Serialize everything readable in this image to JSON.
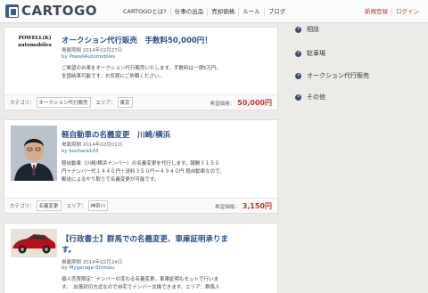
{
  "header": {
    "logo_text": "CARTOGO",
    "nav": [
      "CARTOGOとは?",
      "仕事の出品",
      "売却価格",
      "ルール",
      "ブログ"
    ],
    "account": [
      "新規登録",
      "ログイン"
    ]
  },
  "listings": [
    {
      "thumb_text": "POWELL(K)\nautomobiles",
      "title": "オークション代行販売　手数料50,000円！",
      "date": "掲載期間  2014年02月27日",
      "by_label": "by",
      "author": "PowellAutomobiles",
      "description": [
        "ご希望のお車をオークション代行販売いたします。手数料は一律5万円。",
        "全国納車可能です。お気軽にご依頼ください。"
      ],
      "category_label": "カテゴリ：",
      "category": "オークション代行販売",
      "area_label": "エリア：",
      "area": "東京",
      "price_label": "希望価格：",
      "price": "50,000円"
    },
    {
      "title": "軽自動車の名義変更　川崎/横浜",
      "date": "掲載期間  2014年02月01日",
      "by_label": "by",
      "author": "kouhara103",
      "description": [
        "軽自動車（川崎/横浜ナンバー）の名義変更を代行します。報酬３１５０",
        "円＋ナンバー代１４４０円＋送料３５０円＝４９４０円 軽自動車なので、",
        "郵送によるやり取りで名義変更が可能です。"
      ],
      "category_label": "カテゴリ：",
      "category": "名義変更",
      "area_label": "エリア：",
      "area": "神奈川",
      "price_label": "希望価格：",
      "price": "3,150円"
    },
    {
      "title_lines": [
        "【行政書士】群馬での名義変更、車庫証明承りま",
        "す。"
      ],
      "date": "掲載期間  2014年02月24日",
      "by_label": "by",
      "author": "Mygarage-Shimizu",
      "description": [
        "個人売買限定：ナンバーの変わる名義変更。車庫証明もセットで行いま",
        "す。　出張封印方式なので自宅でナンバー交換できます。エリア：群馬人"
      ]
    }
  ],
  "sidebar": {
    "items": [
      "相談",
      "駐車場",
      "オークション代行販売",
      "その他"
    ]
  },
  "colors": {
    "accent": "#2a4d8f",
    "price": "#c0392b",
    "brand": "#3f5d86"
  }
}
